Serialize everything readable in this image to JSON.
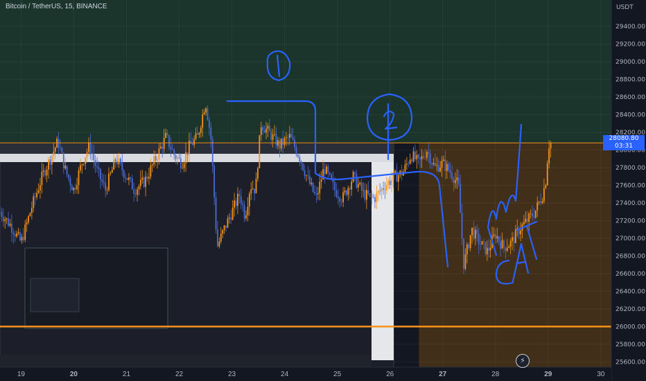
{
  "symbol": {
    "title": "Bitcoin / TetherUS, 15, BINANCE"
  },
  "scale": {
    "currency": "USDT",
    "last_price": "28080.80",
    "countdown": "03:31"
  },
  "colors": {
    "background": "#131722",
    "upper_zone": "#1d3b2f",
    "lower_zone": "#4a3418",
    "candle_up": "#f7931a",
    "candle_down": "#4a6bd6",
    "drawing_blue": "#2962ff",
    "level_line": "#f7931a"
  },
  "chart_data": {
    "type": "candlestick",
    "title": "Bitcoin / TetherUS, 15, BINANCE",
    "y_unit": "USDT",
    "y_ticks": [
      25600,
      25800,
      26000,
      26200,
      26400,
      26600,
      26800,
      27000,
      27200,
      27400,
      27600,
      27800,
      28000,
      28200,
      28400,
      28600,
      28800,
      29000,
      29200,
      29400
    ],
    "y_tick_labels": [
      "25600.00",
      "25800.00",
      "26000.00",
      "26200.00",
      "26400.00",
      "26600.00",
      "26800.00",
      "27000.00",
      "27200.00",
      "27400.00",
      "27600.00",
      "27800.00",
      "28000.00",
      "28200.00",
      "28400.00",
      "28600.00",
      "28800.00",
      "29000.00",
      "29200.00",
      "29400.00"
    ],
    "ylim": [
      25540,
      29700
    ],
    "x_ticks": [
      "19",
      "20",
      "21",
      "22",
      "23",
      "24",
      "25",
      "26",
      "27",
      "28",
      "29",
      "30"
    ],
    "x_tick_bold": [
      false,
      true,
      false,
      false,
      false,
      false,
      false,
      false,
      true,
      false,
      true,
      false
    ],
    "xlim": [
      18.6,
      30.2
    ],
    "candles_xrange": [
      18.6,
      29.05
    ],
    "price_path": [
      [
        18.6,
        27300
      ],
      [
        18.8,
        27150
      ],
      [
        19.0,
        26950
      ],
      [
        19.2,
        27350
      ],
      [
        19.4,
        27700
      ],
      [
        19.55,
        27900
      ],
      [
        19.7,
        28100
      ],
      [
        19.85,
        27750
      ],
      [
        20.0,
        27550
      ],
      [
        20.15,
        27850
      ],
      [
        20.3,
        28050
      ],
      [
        20.45,
        27750
      ],
      [
        20.6,
        27550
      ],
      [
        20.8,
        27900
      ],
      [
        21.0,
        27700
      ],
      [
        21.15,
        27550
      ],
      [
        21.35,
        27650
      ],
      [
        21.55,
        27900
      ],
      [
        21.75,
        28150
      ],
      [
        21.9,
        27950
      ],
      [
        22.05,
        27850
      ],
      [
        22.2,
        28050
      ],
      [
        22.35,
        28150
      ],
      [
        22.5,
        28550
      ],
      [
        22.6,
        28150
      ],
      [
        22.72,
        26900
      ],
      [
        22.85,
        27100
      ],
      [
        23.0,
        27300
      ],
      [
        23.15,
        27500
      ],
      [
        23.25,
        27250
      ],
      [
        23.35,
        27600
      ],
      [
        23.45,
        27550
      ],
      [
        23.55,
        28300
      ],
      [
        23.7,
        28200
      ],
      [
        23.9,
        28050
      ],
      [
        24.1,
        28150
      ],
      [
        24.3,
        27900
      ],
      [
        24.45,
        27650
      ],
      [
        24.6,
        27450
      ],
      [
        24.75,
        27800
      ],
      [
        24.95,
        27550
      ],
      [
        25.1,
        27450
      ],
      [
        25.3,
        27700
      ],
      [
        25.5,
        27500
      ],
      [
        25.7,
        27450
      ],
      [
        25.9,
        27600
      ],
      [
        26.1,
        27700
      ],
      [
        26.25,
        27750
      ],
      [
        26.4,
        27950
      ],
      [
        26.55,
        27850
      ],
      [
        26.7,
        28000
      ],
      [
        26.85,
        27800
      ],
      [
        27.0,
        27850
      ],
      [
        27.15,
        27750
      ],
      [
        27.3,
        27600
      ],
      [
        27.4,
        26700
      ],
      [
        27.55,
        27100
      ],
      [
        27.7,
        26950
      ],
      [
        27.85,
        26850
      ],
      [
        28.0,
        27050
      ],
      [
        28.15,
        26900
      ],
      [
        28.3,
        26950
      ],
      [
        28.45,
        27100
      ],
      [
        28.6,
        27200
      ],
      [
        28.75,
        27300
      ],
      [
        28.9,
        27500
      ],
      [
        28.97,
        27700
      ],
      [
        29.0,
        28050
      ],
      [
        29.05,
        28080
      ]
    ],
    "horizontal_levels": [
      {
        "price": 28080.8,
        "label": "28080.80"
      },
      {
        "price": 26000
      }
    ],
    "zones": [
      {
        "from": 28080.8,
        "to": 29700,
        "fill": "upper_zone"
      },
      {
        "from": 25540,
        "to": 28080.8,
        "x_from": 26.55,
        "fill": "lower_zone"
      }
    ],
    "annotations": [
      "1",
      "2",
      "CAT"
    ]
  }
}
